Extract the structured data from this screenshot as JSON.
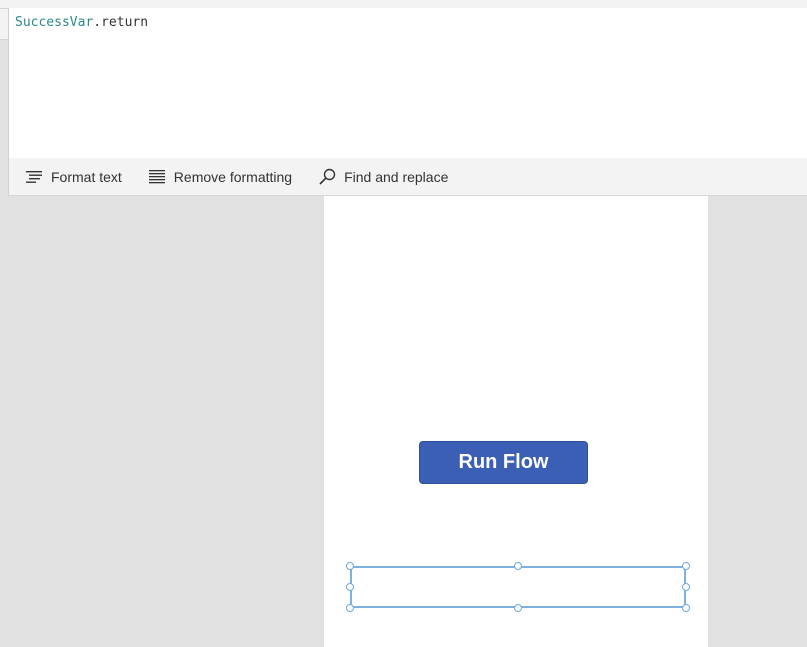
{
  "formula": {
    "variable": "SuccessVar",
    "member": ".return"
  },
  "toolbar": {
    "format_text": "Format text",
    "remove_formatting": "Remove formatting",
    "find_replace": "Find and replace"
  },
  "canvas": {
    "run_button_label": "Run Flow",
    "button_color": "#3a5fb5",
    "selection_color": "#7fb1e0"
  },
  "icons": {
    "format_text": "format-text-icon",
    "remove_formatting": "remove-formatting-icon",
    "find_replace": "search-icon"
  }
}
